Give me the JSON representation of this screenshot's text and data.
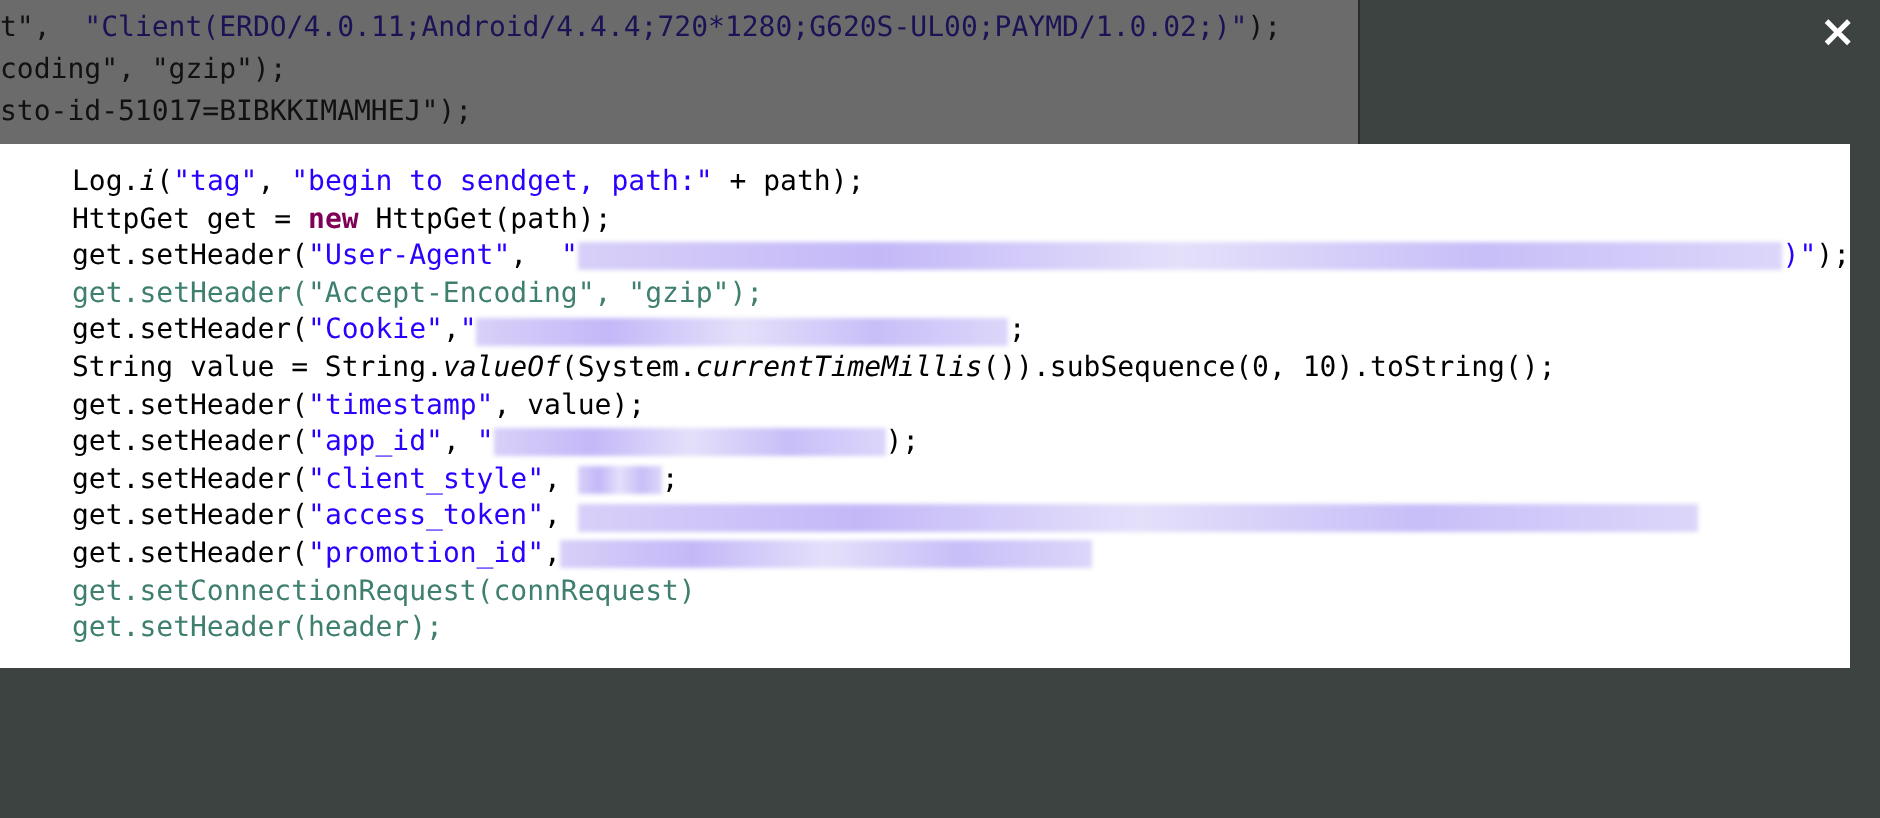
{
  "backdrop_code": [
    [
      {
        "kind": "plain",
        "text": "t\",  "
      },
      {
        "kind": "string",
        "text": "\"Client(ERDO/4.0.11;Android/4.4.4;720*1280;G620S-UL00;PAYMD/1.0.02;)\""
      },
      {
        "kind": "plain",
        "text": ");"
      }
    ],
    [
      {
        "kind": "plain",
        "text": "coding\", \"gzip\");"
      }
    ],
    [
      {
        "kind": "plain",
        "text": "sto-id-51017=BIBKKIMAMHEJ\");"
      }
    ]
  ],
  "close_button": {
    "label": "×"
  },
  "code_lines": [
    [
      {
        "kind": "plain",
        "text": "Log."
      },
      {
        "kind": "italic",
        "text": "i"
      },
      {
        "kind": "plain",
        "text": "("
      },
      {
        "kind": "string",
        "text": "\"tag\""
      },
      {
        "kind": "plain",
        "text": ", "
      },
      {
        "kind": "string",
        "text": "\"begin to sendget, path:\""
      },
      {
        "kind": "plain",
        "text": " + path);"
      }
    ],
    [
      {
        "kind": "plain",
        "text": "HttpGet get = "
      },
      {
        "kind": "keyword",
        "text": "new"
      },
      {
        "kind": "plain",
        "text": " HttpGet(path);"
      }
    ],
    [
      {
        "kind": "plain",
        "text": "get.setHeader("
      },
      {
        "kind": "string",
        "text": "\"User-Agent\""
      },
      {
        "kind": "plain",
        "text": ",  "
      },
      {
        "kind": "string",
        "text": "\""
      },
      {
        "kind": "redacted_long"
      },
      {
        "kind": "string",
        "text": ")\""
      },
      {
        "kind": "plain",
        "text": ");"
      }
    ],
    [
      {
        "kind": "inactive",
        "text": "get.setHeader(\"Accept-Encoding\", \"gzip\");"
      }
    ],
    [
      {
        "kind": "plain",
        "text": "get.setHeader("
      },
      {
        "kind": "string",
        "text": "\"Cookie\""
      },
      {
        "kind": "plain",
        "text": ","
      },
      {
        "kind": "string",
        "text": "\""
      },
      {
        "kind": "redacted_medium"
      },
      {
        "kind": "plain",
        "text": ";"
      }
    ],
    [
      {
        "kind": "plain",
        "text": "String value = String."
      },
      {
        "kind": "italic",
        "text": "valueOf"
      },
      {
        "kind": "plain",
        "text": "(System."
      },
      {
        "kind": "italic",
        "text": "currentTimeMillis"
      },
      {
        "kind": "plain",
        "text": "()).subSequence(0, 10).toString();"
      }
    ],
    [
      {
        "kind": "plain",
        "text": "get.setHeader("
      },
      {
        "kind": "string",
        "text": "\"timestamp\""
      },
      {
        "kind": "plain",
        "text": ", value);"
      }
    ],
    [
      {
        "kind": "plain",
        "text": "get.setHeader("
      },
      {
        "kind": "string",
        "text": "\"app_id\""
      },
      {
        "kind": "plain",
        "text": ", "
      },
      {
        "kind": "string",
        "text": "\""
      },
      {
        "kind": "redacted_short"
      },
      {
        "kind": "plain",
        "text": ");"
      }
    ],
    [
      {
        "kind": "plain",
        "text": "get.setHeader("
      },
      {
        "kind": "string",
        "text": "\"client_style\""
      },
      {
        "kind": "plain",
        "text": ", "
      },
      {
        "kind": "redacted_tiny"
      },
      {
        "kind": "plain",
        "text": ";"
      }
    ],
    [
      {
        "kind": "plain",
        "text": "get.setHeader("
      },
      {
        "kind": "string",
        "text": "\"access_token\""
      },
      {
        "kind": "plain",
        "text": ", "
      },
      {
        "kind": "redacted_wide"
      }
    ],
    [
      {
        "kind": "plain",
        "text": "get.setHeader("
      },
      {
        "kind": "string",
        "text": "\"promotion_id\""
      },
      {
        "kind": "plain",
        "text": ","
      },
      {
        "kind": "redacted_medium"
      }
    ],
    [
      {
        "kind": "inactive",
        "text": "get.setConnectionRequest(connRequest)"
      }
    ],
    [
      {
        "kind": "inactive",
        "text": "get.setHeader(header);"
      }
    ]
  ]
}
